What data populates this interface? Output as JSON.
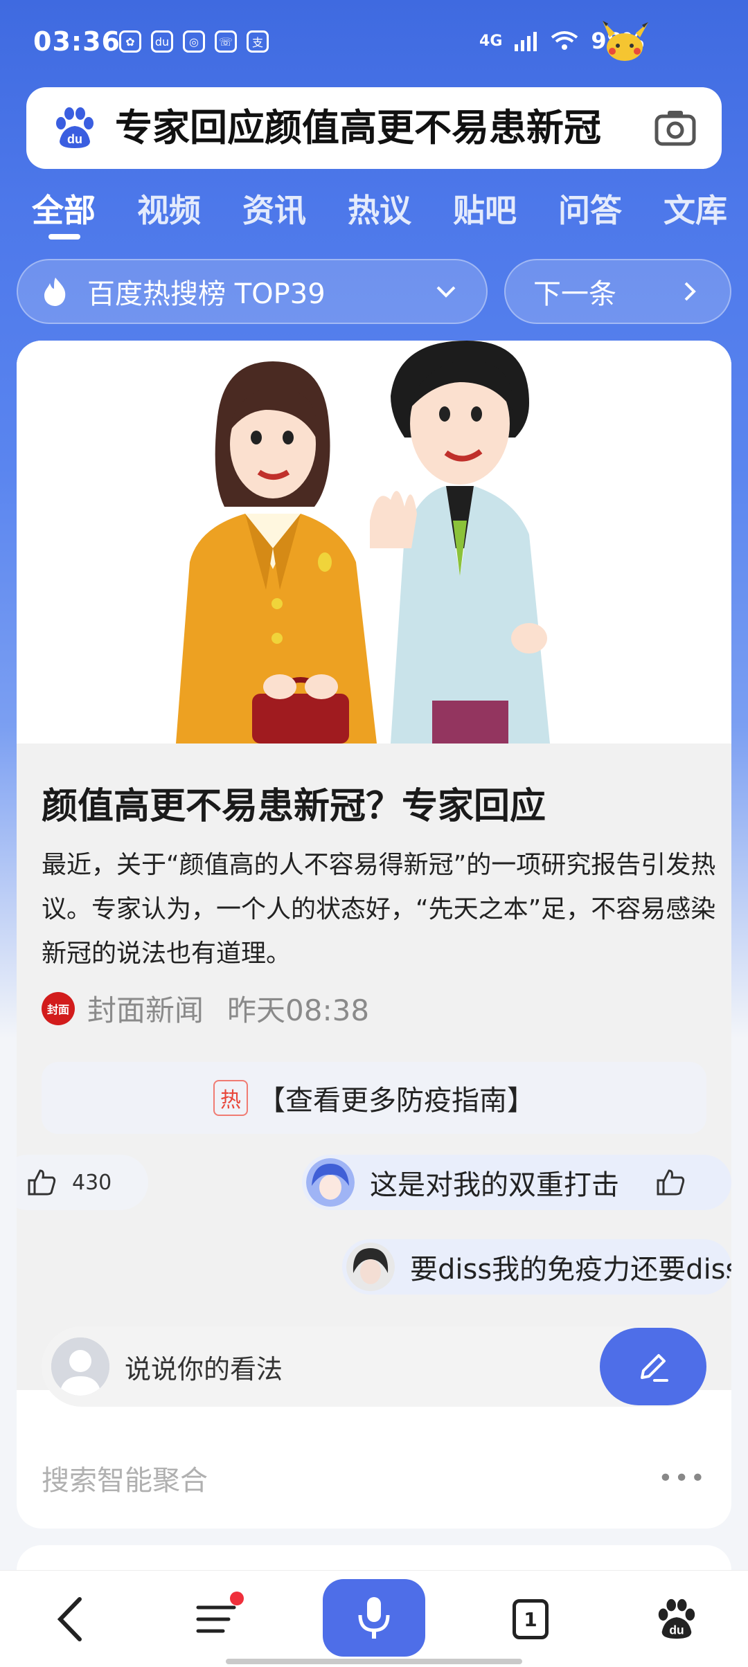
{
  "status_bar": {
    "time": "03:36",
    "network": "4G",
    "battery": "98%"
  },
  "search": {
    "query": "专家回应颜值高更不易患新冠"
  },
  "tabs": [
    {
      "label": "全部",
      "active": true
    },
    {
      "label": "视频"
    },
    {
      "label": "资讯"
    },
    {
      "label": "热议"
    },
    {
      "label": "贴吧"
    },
    {
      "label": "问答"
    },
    {
      "label": "文库"
    }
  ],
  "hot_bar": {
    "label": "百度热搜榜 TOP39",
    "next_label": "下一条"
  },
  "article": {
    "title": "颜值高更不易患新冠？专家回应",
    "summary": "最近，关于“颜值高的人不容易得新冠”的一项研究报告引发热议。专家认为，一个人的状态好，“先天之本”足，不容易感染新冠的说法也有道理。",
    "source": "封面新闻",
    "source_logo_text": "封面",
    "time": "昨天08:38"
  },
  "guide": {
    "tag": "热",
    "label": "【查看更多防疫指南】"
  },
  "likes": {
    "count": "430"
  },
  "danmu": [
    {
      "text": "这是对我的双重打击"
    },
    {
      "text": "要diss我的免疫力还要diss我的颜值"
    }
  ],
  "comment": {
    "placeholder": "说说你的看法"
  },
  "aggregation": {
    "label": "搜索智能聚合"
  },
  "bottom_nav": {
    "tab_count": "1"
  },
  "colors": {
    "accent": "#4e6ee8",
    "header_blue": "#3f6ae0",
    "hot_red": "#e8463a"
  }
}
